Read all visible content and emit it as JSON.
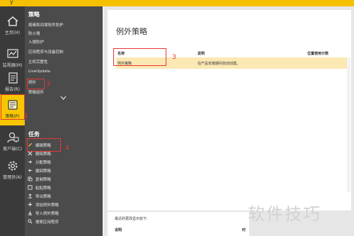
{
  "window": {
    "title_fragment": "y"
  },
  "rail": {
    "items": [
      {
        "label": "主页(H)"
      },
      {
        "label": "监视器(M)"
      },
      {
        "label": "报告(R)"
      },
      {
        "label": "策略(P)"
      },
      {
        "label": "客户端(C)"
      },
      {
        "label": "管理员(A)"
      }
    ]
  },
  "subnav": {
    "section1_title": "策略",
    "items": [
      "病毒和间谍软件防护",
      "防火墙",
      "入侵防护",
      "应用程序与设备控制",
      "主机完整性",
      "LiveUpdate",
      "例外",
      "策略组件"
    ],
    "section2_title": "任务",
    "tasks": [
      "编辑策略",
      "删除策略",
      "分配策略",
      "撤回策略",
      "复制策略",
      "粘贴策略",
      "导出策略",
      "添加例外策略",
      "导入例外策略",
      "搜索应用程序"
    ]
  },
  "main": {
    "page_title": "例外策略",
    "table": {
      "headers": [
        "名称",
        "说明",
        "位置使用计数"
      ],
      "rows": [
        {
          "name": "例外策略",
          "description": "在产品安装期间自动创建。",
          "count": ""
        }
      ]
    },
    "bottom": {
      "hint": "最近的更改显示如下:",
      "col1": "说明",
      "col2": "时"
    }
  },
  "annotations": [
    "1",
    "2",
    "3",
    "4"
  ],
  "watermark": "软件技巧",
  "colors": {
    "accent": "#f7c600",
    "highlight_row": "#fbe8b3",
    "annotation": "#e53935",
    "rail_bg": "#3a3a3a",
    "nav_bg": "#4b4b4b"
  }
}
